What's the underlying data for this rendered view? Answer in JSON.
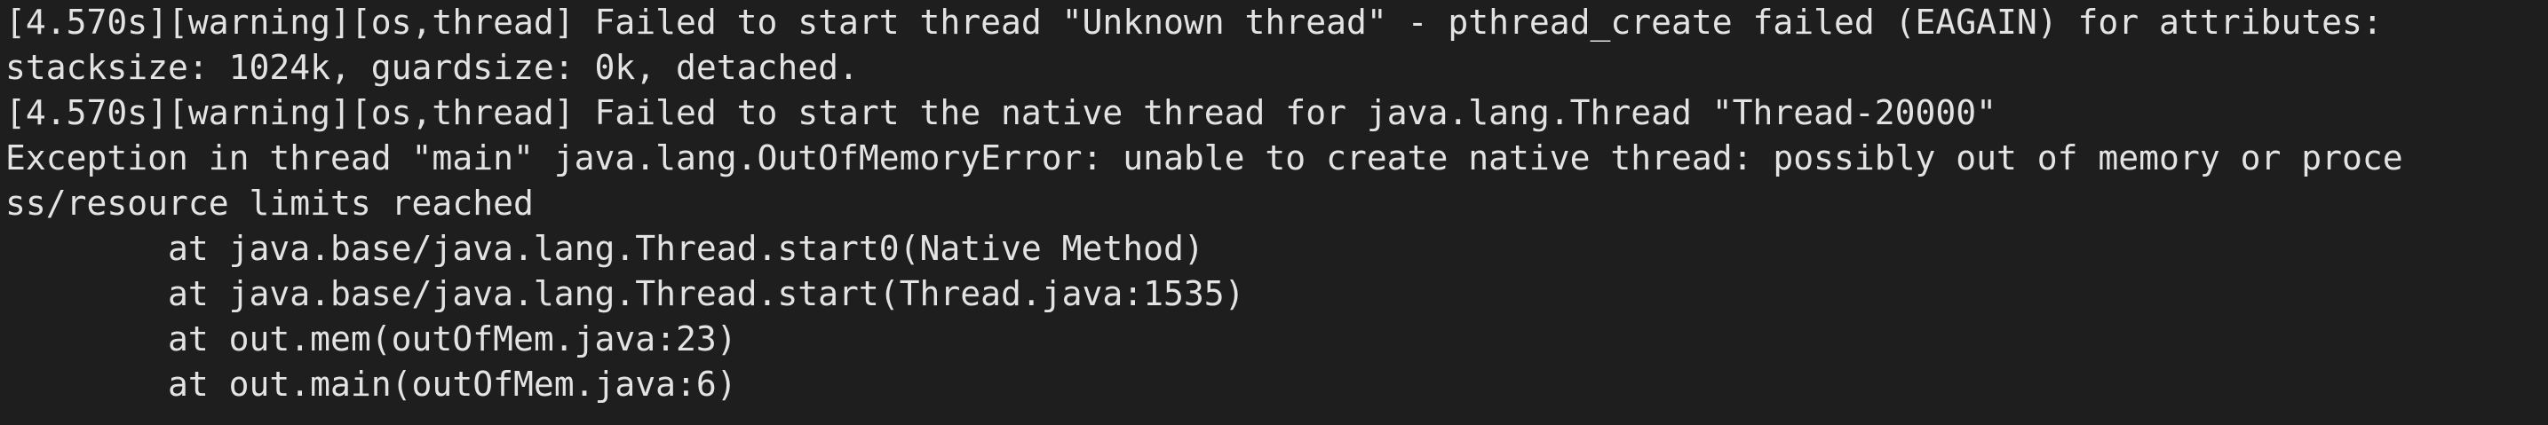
{
  "terminal": {
    "lines": [
      "[4.570s][warning][os,thread] Failed to start thread \"Unknown thread\" - pthread_create failed (EAGAIN) for attributes:",
      "stacksize: 1024k, guardsize: 0k, detached.",
      "[4.570s][warning][os,thread] Failed to start the native thread for java.lang.Thread \"Thread-20000\"",
      "Exception in thread \"main\" java.lang.OutOfMemoryError: unable to create native thread: possibly out of memory or proce",
      "ss/resource limits reached",
      "        at java.base/java.lang.Thread.start0(Native Method)",
      "        at java.base/java.lang.Thread.start(Thread.java:1535)",
      "        at out.mem(outOfMem.java:23)",
      "        at out.main(outOfMem.java:6)"
    ]
  },
  "colors": {
    "background": "#1e1e1e",
    "foreground": "#e3e3e3"
  }
}
